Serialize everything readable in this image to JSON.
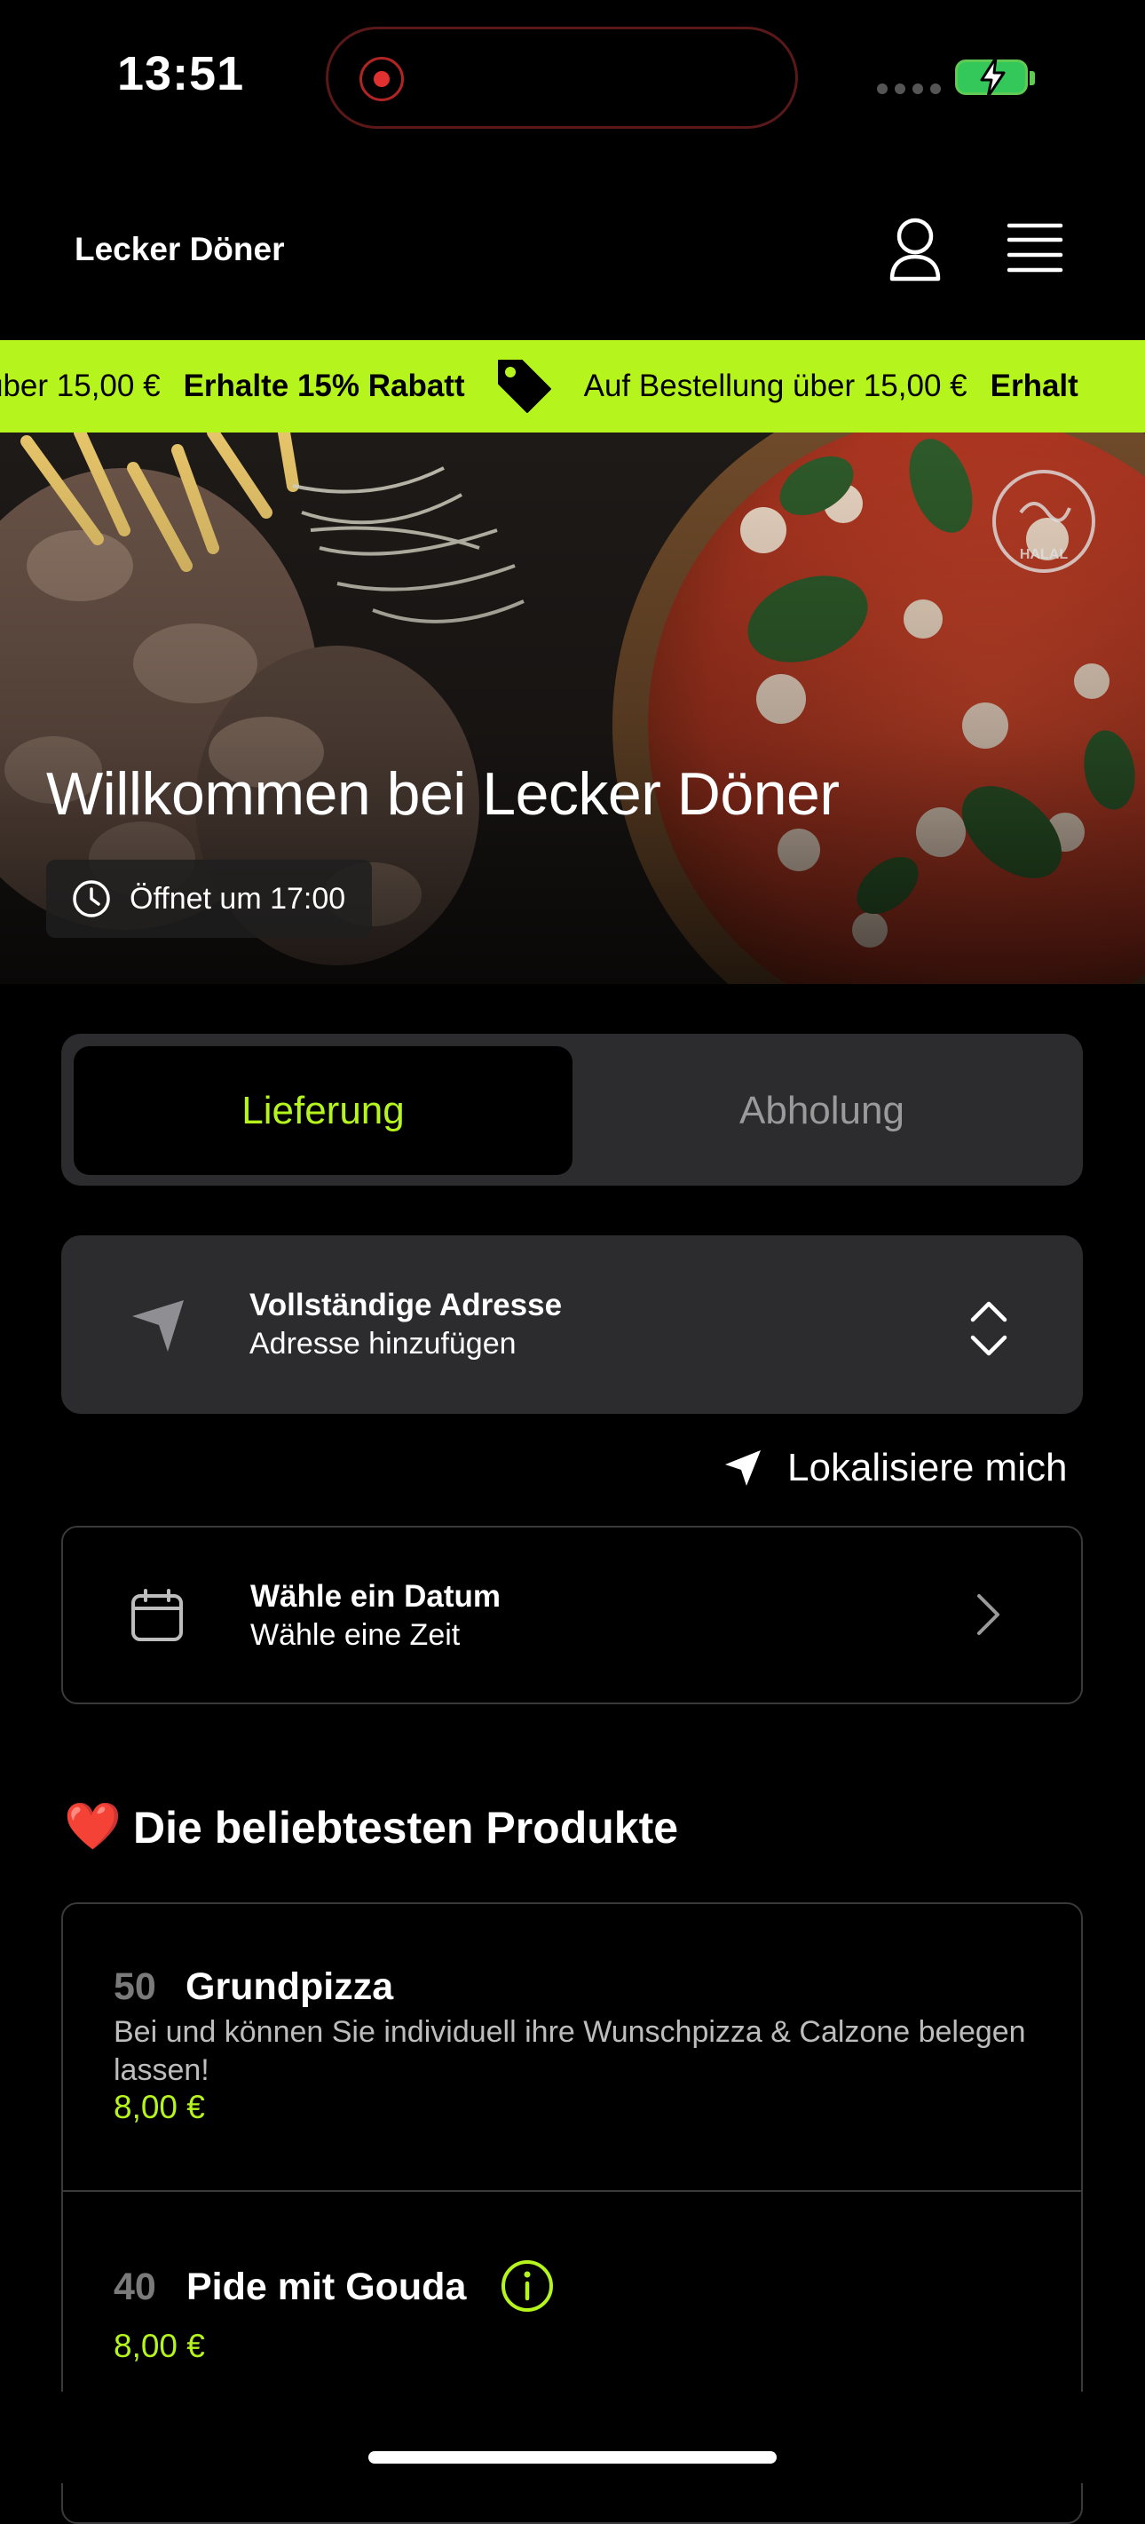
{
  "status_bar": {
    "time": "13:51"
  },
  "header": {
    "brand": "Lecker Döner",
    "user_icon": "user-icon",
    "menu_icon": "hamburger-menu-icon"
  },
  "promo": {
    "text_tail": "über 15,00 €",
    "offer": "Erhalte 15% Rabatt",
    "text": "Auf Bestellung über 15,00 €",
    "offer_cut": "Erhalt",
    "background": "#b5f51d",
    "tag_icon": "price-tag-icon"
  },
  "hero": {
    "title": "Willkommen bei Lecker Döner",
    "hours": "Öffnet um 17:00",
    "halal_badge_text": "HALAL"
  },
  "order_mode": {
    "delivery": "Lieferung",
    "pickup": "Abholung",
    "selected": "Lieferung"
  },
  "address": {
    "title": "Vollständige Adresse",
    "subtitle": "Adresse hinzufügen"
  },
  "locate": {
    "label": "Lokalisiere mich"
  },
  "date": {
    "title": "Wähle ein Datum",
    "subtitle": "Wähle eine Zeit"
  },
  "popular": {
    "title": "Die beliebtesten Produkte",
    "icon": "❤️",
    "products": [
      {
        "number": "50",
        "name": "Grundpizza",
        "description": "Bei und können Sie individuell ihre Wunschpizza & Calzone belegen lassen!",
        "price": "8,00 €"
      },
      {
        "number": "40",
        "name": "Pide mit Gouda",
        "price": "8,00 €"
      }
    ]
  },
  "colors": {
    "accent": "#b5f51d",
    "card": "#2c2c2e",
    "background": "#000000"
  }
}
